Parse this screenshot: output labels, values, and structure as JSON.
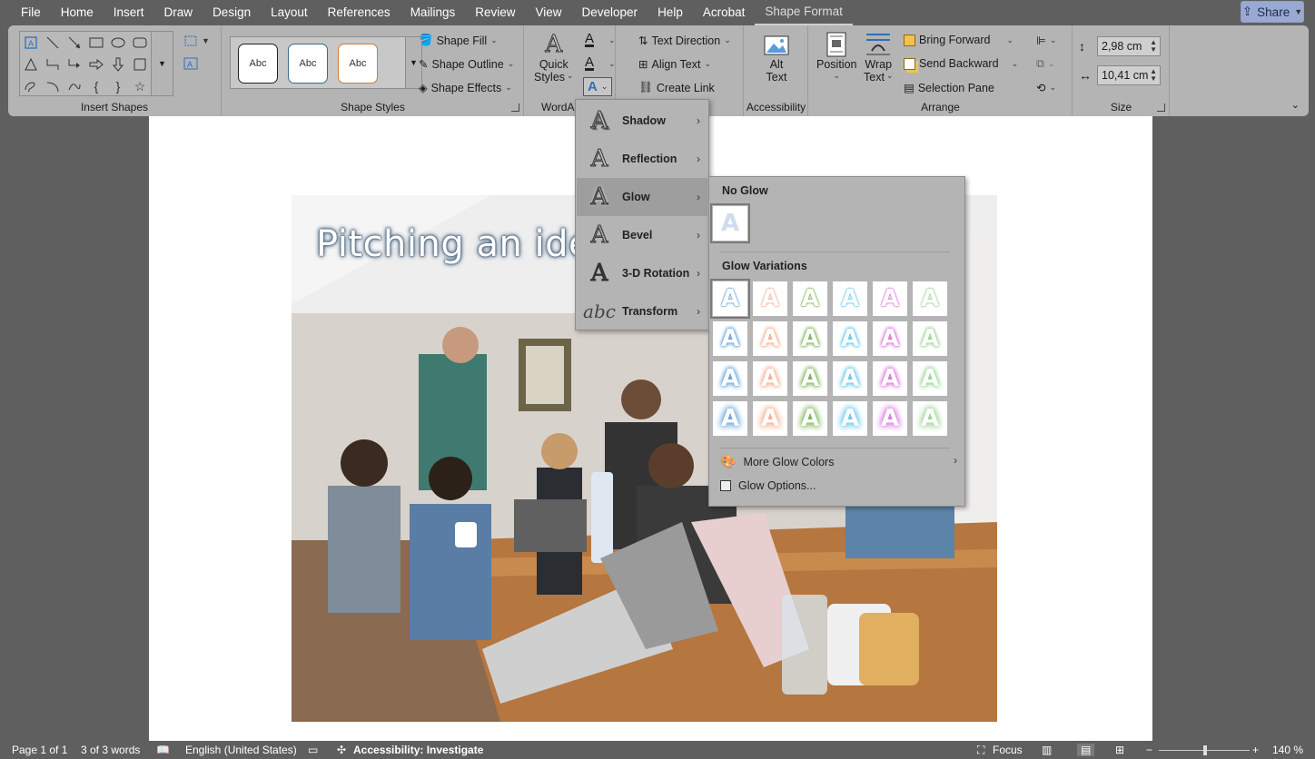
{
  "menu": {
    "items": [
      "File",
      "Home",
      "Insert",
      "Draw",
      "Design",
      "Layout",
      "References",
      "Mailings",
      "Review",
      "View",
      "Developer",
      "Help",
      "Acrobat",
      "Shape Format"
    ],
    "active": "Shape Format",
    "share_label": "Share"
  },
  "ribbon": {
    "insert_shapes": {
      "label": "Insert Shapes"
    },
    "shape_styles": {
      "label": "Shape Styles",
      "samples": [
        "Abc",
        "Abc",
        "Abc"
      ],
      "fill": "Shape Fill",
      "outline": "Shape Outline",
      "effects": "Shape Effects"
    },
    "wordart": {
      "label": "WordArt",
      "quick_styles_line1": "Quick",
      "quick_styles_line2": "Styles"
    },
    "text": {
      "direction": "Text Direction",
      "align": "Align Text",
      "link": "Create Link"
    },
    "accessibility": {
      "label": "Accessibility",
      "alt_line1": "Alt",
      "alt_line2": "Text"
    },
    "arrange": {
      "label": "Arrange",
      "position": "Position",
      "wrap_line1": "Wrap",
      "wrap_line2": "Text",
      "bring_forward": "Bring Forward",
      "send_backward": "Send Backward",
      "selection_pane": "Selection Pane"
    },
    "size": {
      "label": "Size",
      "height": "2,98 cm",
      "width": "10,41 cm"
    }
  },
  "document": {
    "wordart_text": "Pitching an ide"
  },
  "effects_menu": {
    "items": [
      {
        "label": "Shadow",
        "icon": "shadow-icon"
      },
      {
        "label": "Reflection",
        "icon": "reflection-icon"
      },
      {
        "label": "Glow",
        "icon": "glow-icon"
      },
      {
        "label": "Bevel",
        "icon": "bevel-icon"
      },
      {
        "label": "3-D Rotation",
        "icon": "3d-rotation-icon"
      },
      {
        "label": "Transform",
        "icon": "transform-icon"
      }
    ],
    "hovered": "Glow",
    "transform_glyph": "abc"
  },
  "glow_menu": {
    "no_glow_label": "No Glow",
    "variations_label": "Glow Variations",
    "tile_letter": "A",
    "colors": [
      "#5b9bd5",
      "#f4a582",
      "#70ad47",
      "#5bc0eb",
      "#d66bd6",
      "#8fd18a"
    ],
    "more_colors": "More Glow Colors",
    "options": "Glow Options..."
  },
  "status": {
    "page": "Page 1 of 1",
    "words": "3 of 3 words",
    "language": "English (United States)",
    "accessibility": "Accessibility: Investigate",
    "focus": "Focus",
    "zoom": "140 %"
  }
}
